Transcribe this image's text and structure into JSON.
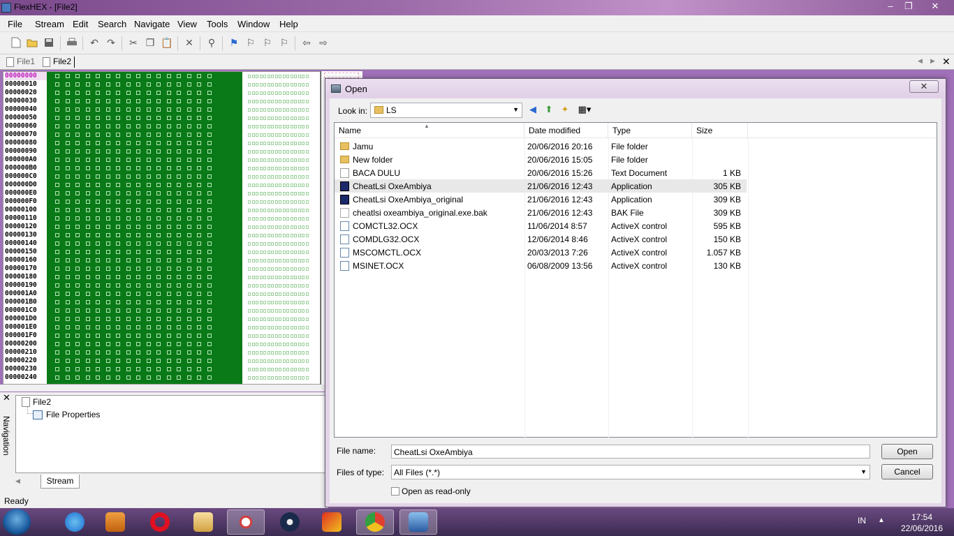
{
  "app": {
    "title": "FlexHEX - [File2]",
    "window_controls": {
      "minimize": "‒",
      "restore": "❐",
      "close": "✕"
    }
  },
  "menu": [
    "File",
    "Stream",
    "Edit",
    "Search",
    "Navigate",
    "View",
    "Tools",
    "Window",
    "Help"
  ],
  "toolbar_icons": [
    "new-file-icon",
    "open-folder-icon",
    "save-icon",
    "print-icon",
    "undo-icon",
    "redo-icon",
    "cut-icon",
    "copy-icon",
    "paste-icon",
    "delete-icon",
    "find-icon",
    "bookmark-flag-icon",
    "prev-bookmark-icon",
    "next-bookmark-icon",
    "clear-bookmarks-icon",
    "back-arrow-icon",
    "forward-arrow-icon"
  ],
  "tabs": [
    "File1",
    "File2"
  ],
  "active_tab": "File2",
  "hex_addresses": [
    "00000000",
    "00000010",
    "00000020",
    "00000030",
    "00000040",
    "00000050",
    "00000060",
    "00000070",
    "00000080",
    "00000090",
    "000000A0",
    "000000B0",
    "000000C0",
    "000000D0",
    "000000E0",
    "000000F0",
    "00000100",
    "00000110",
    "00000120",
    "00000130",
    "00000140",
    "00000150",
    "00000160",
    "00000170",
    "00000180",
    "00000190",
    "000001A0",
    "000001B0",
    "000001C0",
    "000001D0",
    "000001E0",
    "000001F0",
    "00000200",
    "00000210",
    "00000220",
    "00000230",
    "00000240"
  ],
  "navigation": {
    "label": "Navigation",
    "close": "✕",
    "tree": {
      "root": "File2",
      "child": "File Properties"
    },
    "bottom_tab": "Stream"
  },
  "status": "Ready",
  "dialog": {
    "title": "Open",
    "close": "✕",
    "look_in_label": "Look in:",
    "look_in_value": "LS",
    "columns": [
      "Name",
      "Date modified",
      "Type",
      "Size"
    ],
    "files": [
      {
        "name": "Jamu",
        "date": "20/06/2016 20:16",
        "type": "File folder",
        "size": "",
        "icon": "folder"
      },
      {
        "name": "New folder",
        "date": "20/06/2016 15:05",
        "type": "File folder",
        "size": "",
        "icon": "folder"
      },
      {
        "name": "BACA DULU",
        "date": "20/06/2016 15:26",
        "type": "Text Document",
        "size": "1 KB",
        "icon": "txt"
      },
      {
        "name": "CheatLsi OxeAmbiya",
        "date": "21/06/2016 12:43",
        "type": "Application",
        "size": "305 KB",
        "icon": "app",
        "selected": true
      },
      {
        "name": "CheatLsi OxeAmbiya_original",
        "date": "21/06/2016 12:43",
        "type": "Application",
        "size": "309 KB",
        "icon": "app"
      },
      {
        "name": "cheatlsi oxeambiya_original.exe.bak",
        "date": "21/06/2016 12:43",
        "type": "BAK File",
        "size": "309 KB",
        "icon": "bak"
      },
      {
        "name": "COMCTL32.OCX",
        "date": "11/06/2014 8:57",
        "type": "ActiveX control",
        "size": "595 KB",
        "icon": "ocx"
      },
      {
        "name": "COMDLG32.OCX",
        "date": "12/06/2014 8:46",
        "type": "ActiveX control",
        "size": "150 KB",
        "icon": "ocx"
      },
      {
        "name": "MSCOMCTL.OCX",
        "date": "20/03/2013 7:26",
        "type": "ActiveX control",
        "size": "1.057 KB",
        "icon": "ocx"
      },
      {
        "name": "MSINET.OCX",
        "date": "06/08/2009 13:56",
        "type": "ActiveX control",
        "size": "130 KB",
        "icon": "ocx"
      }
    ],
    "file_name_label": "File name:",
    "file_name_value": "CheatLsi OxeAmbiya",
    "file_type_label": "Files of type:",
    "file_type_value": "All Files (*.*)",
    "open_button": "Open",
    "cancel_button": "Cancel",
    "readonly_label": "Open as read-only"
  },
  "taskbar": {
    "apps": [
      "internet-explorer-icon",
      "media-player-icon",
      "opera-icon",
      "file-explorer-icon",
      "snipping-tool-icon",
      "steam-icon",
      "game-icon",
      "chrome-icon",
      "flexhex-icon"
    ],
    "language": "IN",
    "tray_arrow": "▲",
    "time": "17:54",
    "date": "22/06/2016"
  }
}
